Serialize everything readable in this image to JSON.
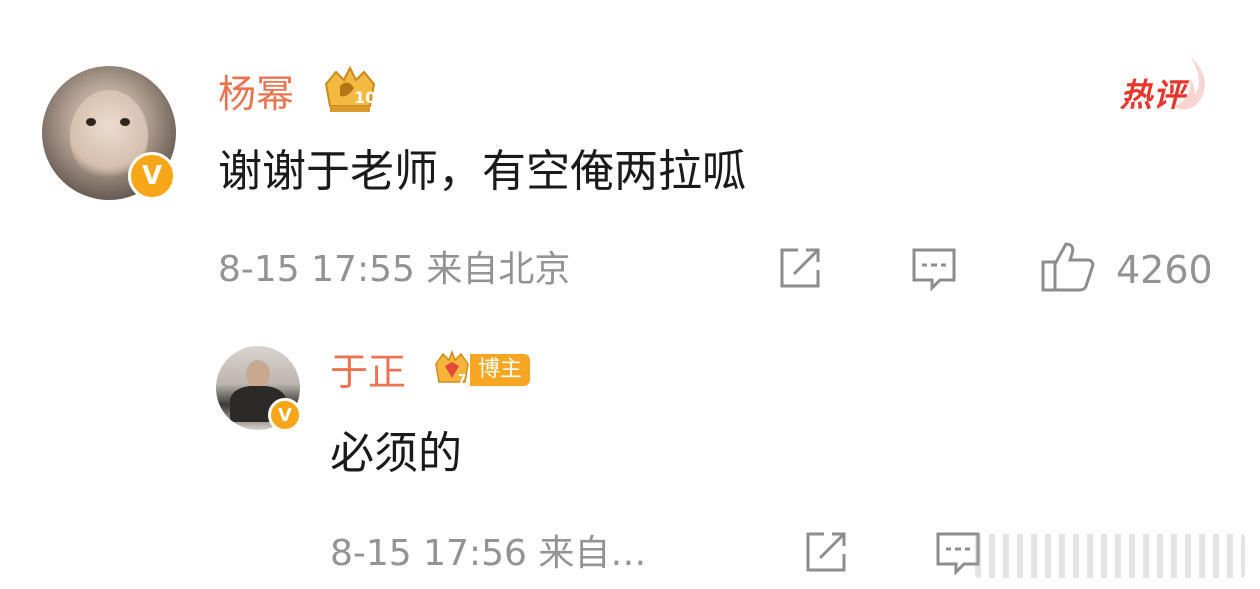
{
  "comment": {
    "username": "杨幂",
    "badge_level": "10",
    "hot_label": "热评",
    "text": "谢谢于老师，有空俺两拉呱",
    "meta": "8-15 17:55  来自北京",
    "like_count": "4260"
  },
  "reply": {
    "username": "于正",
    "badge_label": "博主",
    "badge_level": "7",
    "text": "必须的",
    "meta": "8-15 17:56  来自…"
  },
  "colors": {
    "name": "#eb7350",
    "verified": "#f7a617",
    "hot": "#e8362d",
    "meta": "#939393"
  },
  "icons": [
    "verified-v-icon",
    "crown-badge-icon",
    "share-icon",
    "comment-icon",
    "like-icon"
  ]
}
